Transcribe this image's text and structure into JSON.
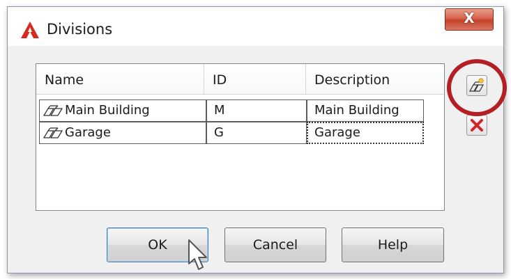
{
  "dialog": {
    "title": "Divisions",
    "app_icon": "autocad-a-logo-icon",
    "close_glyph": "X",
    "colors": {
      "accent_ring": "#b31f24",
      "close_button": "#c6412a"
    }
  },
  "list": {
    "columns": [
      "Name",
      "ID",
      "Description"
    ],
    "rows": [
      {
        "name": "Main Building",
        "id": "M",
        "description": "Main Building"
      },
      {
        "name": "Garage",
        "id": "G",
        "description": "Garage"
      }
    ],
    "row_icon": "division-icon"
  },
  "side_buttons": {
    "new_icon": "new-division-icon",
    "delete_icon": "delete-x-icon"
  },
  "buttons": {
    "ok": "OK",
    "cancel": "Cancel",
    "help": "Help"
  }
}
